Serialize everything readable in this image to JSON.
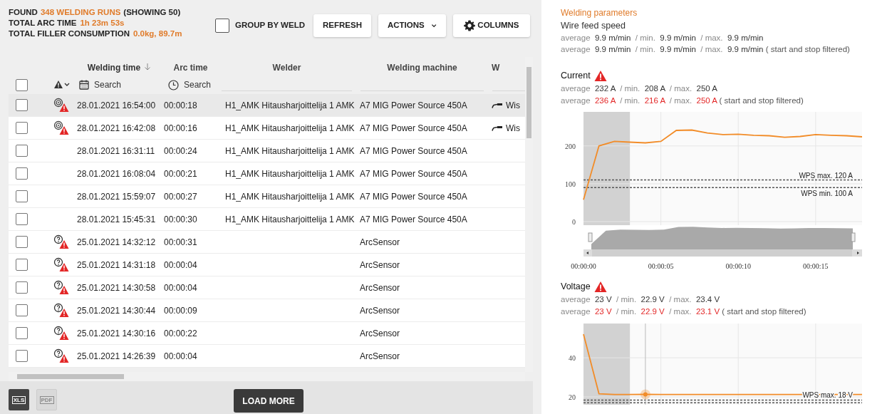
{
  "summary": {
    "found": {
      "label": "FOUND",
      "value": "348 WELDING RUNS",
      "suffix": "(SHOWING 50)"
    },
    "lines": [
      {
        "label": "TOTAL ARC TIME",
        "value": "1h 23m 53s"
      },
      {
        "label": "TOTAL FILLER CONSUMPTION",
        "value": "0.0kg, 89.7m"
      }
    ]
  },
  "toolbar": {
    "group_by_weld": {
      "label": "GROUP BY WELD",
      "checked": false
    },
    "buttons": [
      {
        "label": "REFRESH",
        "kind": "plain"
      },
      {
        "label": "ACTIONS",
        "kind": "dropdown"
      },
      {
        "label": "COLUMNS",
        "kind": "gear"
      }
    ]
  },
  "table": {
    "select_all": {
      "checked": false
    },
    "columns": [
      {
        "label": "Welding time",
        "sorted": true
      },
      {
        "label": "Arc time",
        "sorted": false
      },
      {
        "label": "Welder",
        "sorted": false
      },
      {
        "label": "Welding machine",
        "sorted": false
      },
      {
        "label": "W",
        "sorted": false
      }
    ],
    "filters": [
      {
        "kind": "date",
        "placeholder": "Search"
      },
      {
        "kind": "time",
        "placeholder": "Search"
      },
      {
        "kind": "text"
      },
      {
        "kind": "text"
      },
      {
        "kind": "text"
      }
    ],
    "rows": [
      {
        "checked": false,
        "highlighted": true,
        "kind": "spool_warning",
        "time": "28.01.2021 16:54:00",
        "arc_time": "00:00:18",
        "welder": "H1_AMK Hitausharjoittelija 1 AMK",
        "machine": "A7 MIG Power Source 450A",
        "column_5": "Wis"
      },
      {
        "checked": false,
        "highlighted": false,
        "kind": "spool_warning",
        "time": "28.01.2021 16:42:08",
        "arc_time": "00:00:16",
        "welder": "H1_AMK Hitausharjoittelija 1 AMK",
        "machine": "A7 MIG Power Source 450A",
        "column_5": "Wis"
      },
      {
        "checked": false,
        "highlighted": false,
        "kind": "plain",
        "time": "28.01.2021 16:31:11",
        "arc_time": "00:00:24",
        "welder": "H1_AMK Hitausharjoittelija 1 AMK",
        "machine": "A7 MIG Power Source 450A"
      },
      {
        "checked": false,
        "highlighted": false,
        "kind": "plain",
        "time": "28.01.2021 16:08:04",
        "arc_time": "00:00:21",
        "welder": "H1_AMK Hitausharjoittelija 1 AMK",
        "machine": "A7 MIG Power Source 450A"
      },
      {
        "checked": false,
        "highlighted": false,
        "kind": "plain",
        "time": "28.01.2021 15:59:07",
        "arc_time": "00:00:27",
        "welder": "H1_AMK Hitausharjoittelija 1 AMK",
        "machine": "A7 MIG Power Source 450A"
      },
      {
        "checked": false,
        "highlighted": false,
        "kind": "plain",
        "time": "28.01.2021 15:45:31",
        "arc_time": "00:00:30",
        "welder": "H1_AMK Hitausharjoittelija 1 AMK",
        "machine": "A7 MIG Power Source 450A"
      },
      {
        "checked": false,
        "highlighted": false,
        "kind": "unknown_warning",
        "time": "25.01.2021 14:32:12",
        "arc_time": "00:00:31",
        "machine": "ArcSensor"
      },
      {
        "checked": false,
        "highlighted": false,
        "kind": "unknown_warning",
        "time": "25.01.2021 14:31:18",
        "arc_time": "00:00:04",
        "machine": "ArcSensor"
      },
      {
        "checked": false,
        "highlighted": false,
        "kind": "unknown_warning",
        "time": "25.01.2021 14:30:58",
        "arc_time": "00:00:04",
        "machine": "ArcSensor"
      },
      {
        "checked": false,
        "highlighted": false,
        "kind": "unknown_warning",
        "time": "25.01.2021 14:30:44",
        "arc_time": "00:00:09",
        "machine": "ArcSensor"
      },
      {
        "checked": false,
        "highlighted": false,
        "kind": "unknown_warning",
        "time": "25.01.2021 14:30:16",
        "arc_time": "00:00:22",
        "machine": "ArcSensor"
      },
      {
        "checked": false,
        "highlighted": false,
        "kind": "unknown_warning",
        "time": "25.01.2021 14:26:39",
        "arc_time": "00:00:04",
        "machine": "ArcSensor"
      }
    ]
  },
  "footer": {
    "exports": [
      {
        "label": "XLS",
        "disabled": false
      },
      {
        "label": "PDF",
        "disabled": true
      }
    ],
    "load_more": "LOAD MORE"
  },
  "parameters": {
    "title": "Welding parameters",
    "sections": [
      {
        "title": "Wire feed speed",
        "alert": false,
        "lines": [
          [
            {
              "kind": "label",
              "text": "average"
            },
            {
              "kind": "value",
              "text": "9.9 m/min"
            },
            {
              "kind": "label",
              "text": "/ min."
            },
            {
              "kind": "value",
              "text": "9.9 m/min"
            },
            {
              "kind": "label",
              "text": "/ max."
            },
            {
              "kind": "value",
              "text": "9.9 m/min"
            }
          ],
          [
            {
              "kind": "label",
              "text": "average"
            },
            {
              "kind": "value",
              "text": "9.9 m/min"
            },
            {
              "kind": "label",
              "text": "/ min."
            },
            {
              "kind": "value",
              "text": "9.9 m/min"
            },
            {
              "kind": "label",
              "text": "/ max."
            },
            {
              "kind": "value",
              "text": "9.9 m/min"
            },
            {
              "kind": "note",
              "text": "( start and stop filtered)"
            }
          ]
        ]
      },
      {
        "title": "Current",
        "alert": true,
        "lines": [
          [
            {
              "kind": "label",
              "text": "average"
            },
            {
              "kind": "value",
              "text": "232 A"
            },
            {
              "kind": "label",
              "text": "/ min."
            },
            {
              "kind": "value",
              "text": "208 A"
            },
            {
              "kind": "label",
              "text": "/ max."
            },
            {
              "kind": "value",
              "text": "250 A"
            }
          ],
          [
            {
              "kind": "label",
              "text": "average"
            },
            {
              "kind": "alert_value",
              "text": "236 A"
            },
            {
              "kind": "label",
              "text": "/ min."
            },
            {
              "kind": "alert_value",
              "text": "216 A"
            },
            {
              "kind": "label",
              "text": "/ max."
            },
            {
              "kind": "alert_value",
              "text": "250 A"
            },
            {
              "kind": "note",
              "text": "( start and stop filtered)"
            }
          ]
        ],
        "chart_data": {
          "type": "line",
          "x": [
            0,
            1,
            2,
            3,
            4,
            5,
            6,
            7,
            8,
            9,
            10,
            11,
            12,
            13,
            14,
            15,
            16,
            17,
            18
          ],
          "series": [
            {
              "color": "#f28c28",
              "values": [
                58,
                200,
                212,
                210,
                208,
                212,
                241,
                242,
                234,
                230,
                231,
                228,
                227,
                223,
                225,
                230,
                228,
                227,
                224
              ]
            }
          ],
          "xlim": [
            0,
            18
          ],
          "ylim": [
            0,
            290
          ],
          "yticks": [
            0,
            100,
            200
          ],
          "xticks": [
            {
              "value": 0,
              "label": "00:00:00"
            },
            {
              "value": 5,
              "label": "00:00:05"
            },
            {
              "value": 10,
              "label": "00:00:10"
            },
            {
              "value": 15,
              "label": "00:00:15"
            }
          ],
          "grid": true,
          "ref_lines": [
            {
              "axis": "y",
              "value": 110,
              "label": "WPS max. 120 A"
            },
            {
              "axis": "y",
              "value": 90,
              "label": "WPS min. 100 A"
            }
          ],
          "bands": [
            {
              "axis": "x",
              "from": 0,
              "to": 3
            }
          ]
        }
      },
      {
        "title": "Voltage",
        "alert": true,
        "lines": [
          [
            {
              "kind": "label",
              "text": "average"
            },
            {
              "kind": "value",
              "text": "23 V"
            },
            {
              "kind": "label",
              "text": "/ min."
            },
            {
              "kind": "value",
              "text": "22.9 V"
            },
            {
              "kind": "label",
              "text": "/ max."
            },
            {
              "kind": "value",
              "text": "23.4 V"
            }
          ],
          [
            {
              "kind": "label",
              "text": "average"
            },
            {
              "kind": "alert_value",
              "text": "23 V"
            },
            {
              "kind": "label",
              "text": "/ min."
            },
            {
              "kind": "alert_value",
              "text": "22.9 V"
            },
            {
              "kind": "label",
              "text": "/ max."
            },
            {
              "kind": "alert_value",
              "text": "23.1 V"
            },
            {
              "kind": "note",
              "text": "( start and stop filtered)"
            }
          ]
        ],
        "chart_data": {
          "type": "line",
          "x": [
            0,
            1,
            2,
            3,
            4,
            5,
            6,
            7,
            8,
            9,
            10,
            11,
            12,
            13,
            14,
            15,
            16,
            17,
            18
          ],
          "series": [
            {
              "color": "#f28c28",
              "values": [
                52,
                21.6,
                21.2,
                21.2,
                21.3,
                21.2,
                21.2,
                21.2,
                21.2,
                21.2,
                21.2,
                21.2,
                21.2,
                21.2,
                21.2,
                21.2,
                21.2,
                21.2,
                21.2
              ]
            }
          ],
          "xlim": [
            0,
            18
          ],
          "ylim": [
            16,
            57.5
          ],
          "yticks": [
            20,
            40
          ],
          "grid": true,
          "ref_lines": [
            {
              "axis": "y",
              "value": 18.4,
              "label": "WPS max. 18 V"
            },
            {
              "axis": "y",
              "value": 17
            },
            {
              "axis": "x",
              "value": 4
            }
          ],
          "bands": [
            {
              "axis": "x",
              "from": 0,
              "to": 3
            }
          ]
        }
      }
    ]
  }
}
